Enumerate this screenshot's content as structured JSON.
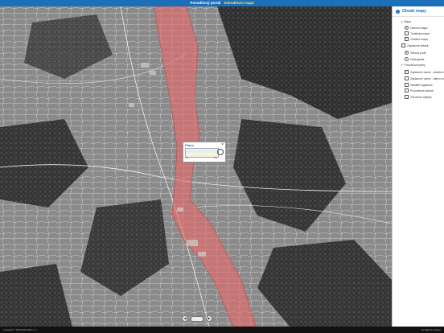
{
  "header": {
    "title": "Povodňový portál",
    "subtitle": "Interaktivní mapa"
  },
  "panel": {
    "title": "Obsah mapy",
    "groups": [
      {
        "label": "Mapa",
        "kind": "group"
      },
      {
        "label": "Obecná mapa",
        "kind": "radio",
        "checked": true
      },
      {
        "label": "Turistická mapa",
        "kind": "check",
        "checked": false
      },
      {
        "label": "Ortofoto mapa",
        "kind": "check",
        "checked": true
      },
      {
        "label": "Záplavové oblasti",
        "kind": "check-plain",
        "checked": false
      },
      {
        "label": "Věkový profil",
        "kind": "radio",
        "checked": true
      },
      {
        "label": "Hydrografie",
        "kind": "radio",
        "checked": false
      },
      {
        "label": "Povodňové plány",
        "kind": "group"
      },
      {
        "label": "Záplavové území - stoletá voda",
        "kind": "check",
        "checked": true
      },
      {
        "label": "Záplavové území - aktivní zóna",
        "kind": "check",
        "checked": false
      },
      {
        "label": "Hlásiště registrace",
        "kind": "check",
        "checked": false
      },
      {
        "label": "Povodňová komise",
        "kind": "check",
        "checked": false
      },
      {
        "label": "Ohrožené objekty",
        "kind": "check",
        "checked": false
      }
    ]
  },
  "popup": {
    "title": "Plano",
    "close": "×",
    "min_label": "min",
    "max_label": "max"
  },
  "controls": {
    "prev": "◀",
    "next": "▶"
  },
  "footer": {
    "left": "Copyright © 2019 DHI Praha s.r.o.",
    "right": "for Data Pro Server"
  },
  "colors": {
    "accent": "#1d6fb8",
    "flood_fill": "#e86b6b"
  }
}
